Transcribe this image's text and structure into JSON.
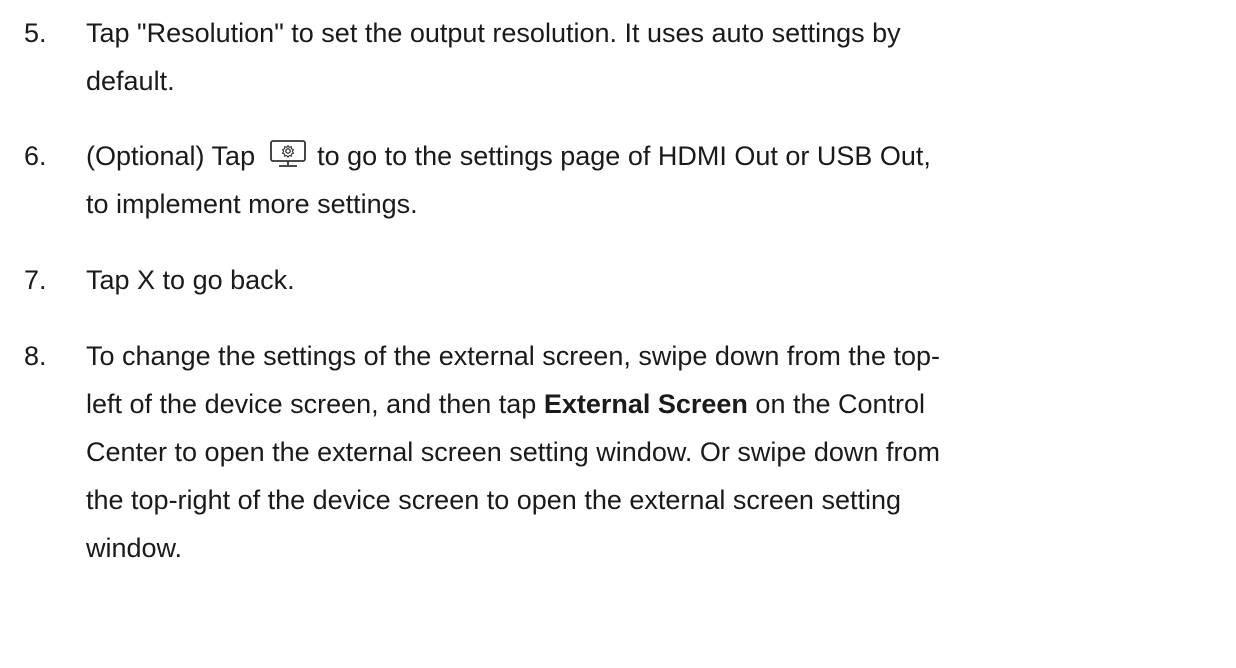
{
  "steps": [
    {
      "number": "5.",
      "lines": [
        "Tap \"Resolution\" to set the output resolution. It uses auto settings by",
        "default."
      ]
    },
    {
      "number": "6.",
      "line1_before": "(Optional) Tap",
      "line1_after": "to go to the settings page of HDMI Out or USB Out,",
      "line2": "to implement more settings.",
      "icon": "monitor-settings-icon"
    },
    {
      "number": "7.",
      "lines": [
        "Tap X to go back."
      ]
    },
    {
      "number": "8.",
      "line1": "To change the settings of the external screen, swipe down from the top-",
      "line2_before": "left of the device screen, and then tap ",
      "line2_bold": "External Screen",
      "line2_after": " on the Control",
      "line3": "Center to open the external screen setting window. Or swipe down from",
      "line4": "the top-right of the device screen to open the external screen setting",
      "line5": "window."
    }
  ]
}
